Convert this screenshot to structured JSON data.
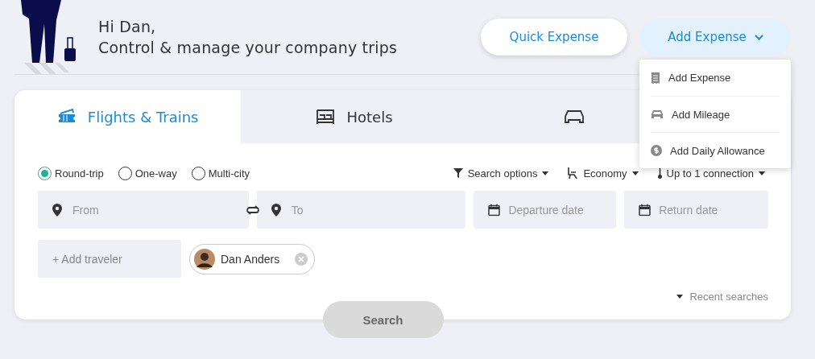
{
  "header": {
    "greeting": "Hi Dan,",
    "subtitle": "Control & manage your company trips",
    "quick_button": "Quick Expense",
    "add_button": {
      "label": "Add Expense",
      "expanded": true
    }
  },
  "add_menu": [
    {
      "kind": "receipt",
      "label": "Add Expense"
    },
    {
      "kind": "car",
      "label": "Add Mileage"
    },
    {
      "kind": "coin",
      "label": "Add Daily Allowance"
    }
  ],
  "tabs": [
    {
      "kind": "ticket",
      "label": "Flights & Trains",
      "selected": true
    },
    {
      "kind": "bed",
      "label": "Hotels",
      "selected": false
    },
    {
      "kind": "car",
      "selected": false
    }
  ],
  "trip_types": [
    {
      "label": "Round-trip",
      "selected": true
    },
    {
      "label": "One-way",
      "selected": false
    },
    {
      "label": "Multi-city",
      "selected": false
    }
  ],
  "options": [
    {
      "kind": "filter",
      "label": "Search options"
    },
    {
      "kind": "seat",
      "label": "Economy"
    },
    {
      "kind": "stop",
      "label": "Up to 1 connection"
    }
  ],
  "fields": [
    {
      "kind": "pin",
      "placeholder": "From"
    },
    {
      "kind": "pin",
      "placeholder": "To"
    },
    {
      "kind": "calendar",
      "placeholder": "Departure date"
    },
    {
      "kind": "calendar",
      "placeholder": "Return date"
    }
  ],
  "add_traveler": "+ Add traveler",
  "travelers": [
    {
      "name": "Dan Anders"
    }
  ],
  "recent_searches": "Recent searches",
  "search_button": "Search"
}
